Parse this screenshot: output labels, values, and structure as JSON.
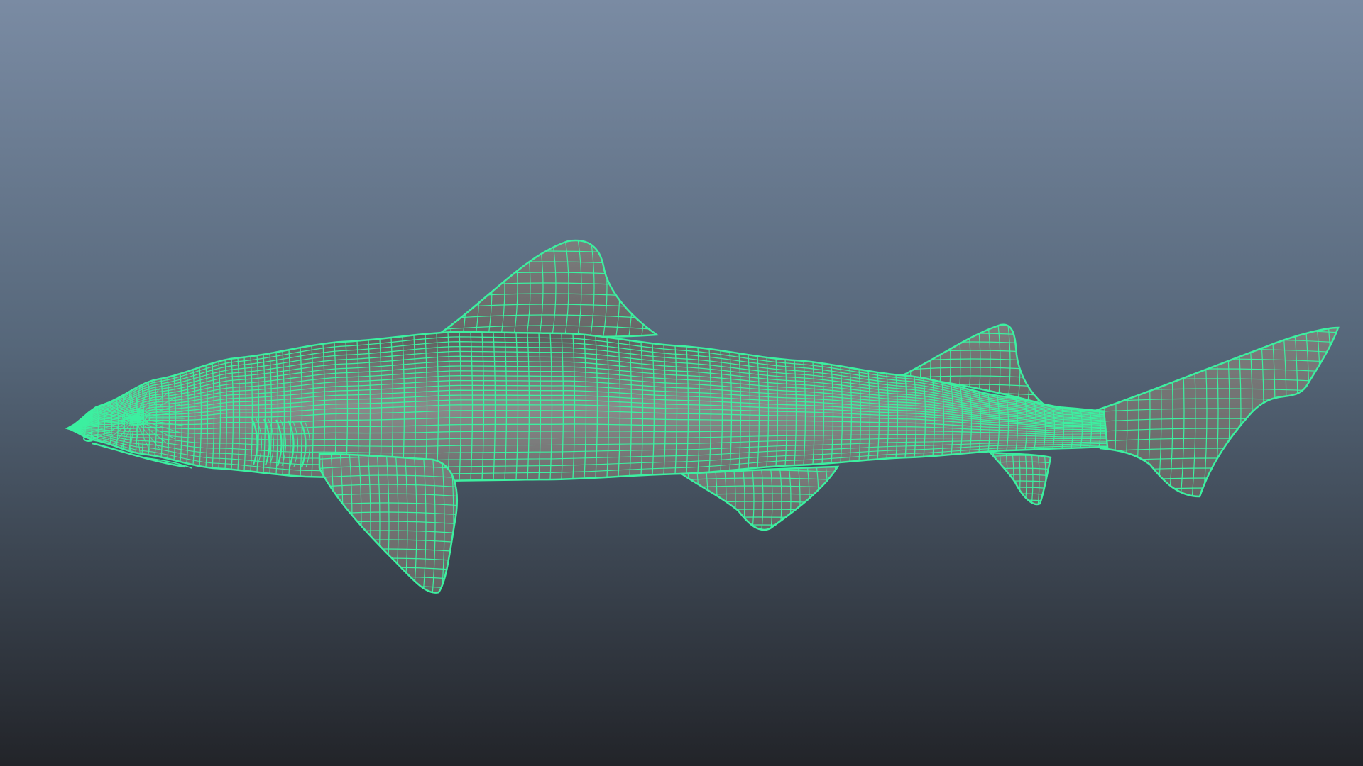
{
  "viewport": {
    "background_top": "#7a8ba3",
    "background_mid": "#56677a",
    "background_bottom": "#222429"
  },
  "model": {
    "name_icon": "shark-mesh",
    "wire_color": "#3cf0a0",
    "shade_top": "#5c5c5c",
    "shade_mid": "#8a8a8a",
    "shade_bottom": "#6c6c6c"
  }
}
